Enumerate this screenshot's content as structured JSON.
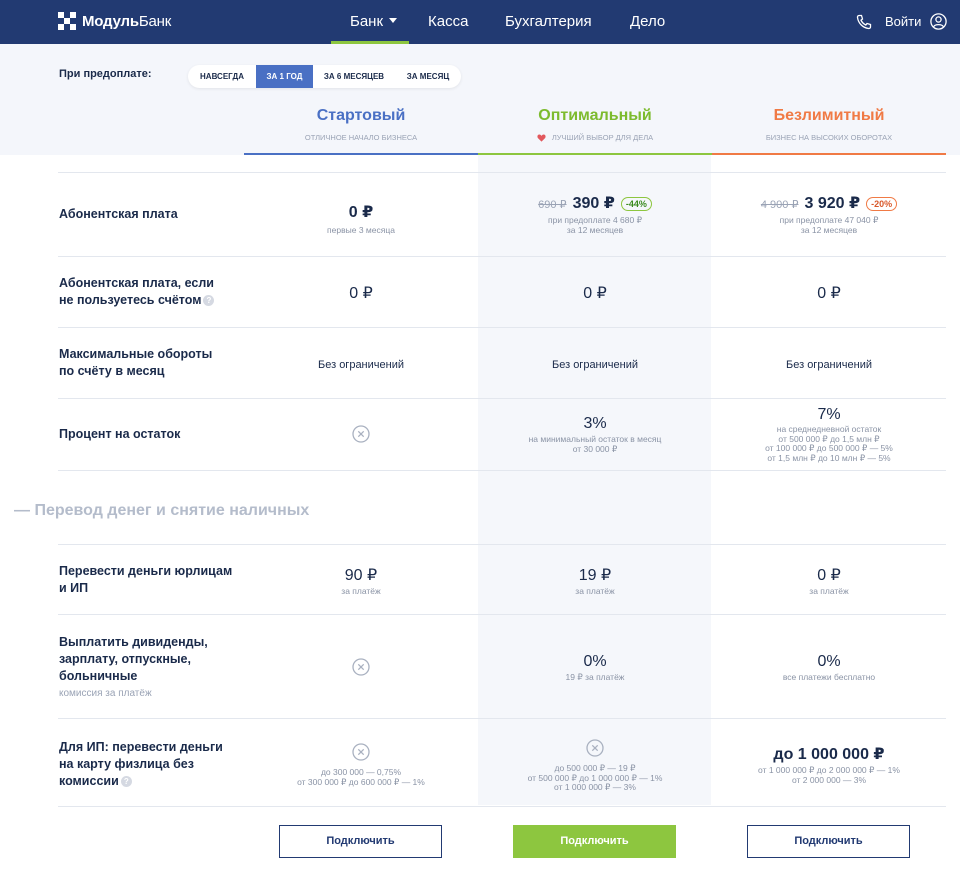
{
  "header": {
    "logo_bold": "Модуль",
    "logo_light": "Банк",
    "nav": [
      "Банк",
      "Касса",
      "Бухгалтерия",
      "Дело"
    ],
    "login": "Войти"
  },
  "prepay": {
    "label": "При предоплате:",
    "options": [
      "НАВСЕГДА",
      "ЗА 1 ГОД",
      "ЗА 6 МЕСЯЦЕВ",
      "ЗА МЕСЯЦ"
    ],
    "active": "ЗА 1 ГОД"
  },
  "plans": [
    {
      "name": "Стартовый",
      "sub": "ОТЛИЧНОЕ НАЧАЛО БИЗНЕСА",
      "color": "#4a70c4"
    },
    {
      "name": "Оптимальный",
      "sub": "ЛУЧШИЙ ВЫБОР ДЛЯ ДЕЛА",
      "color": "#8dc63f"
    },
    {
      "name": "Безлимитный",
      "sub": "БИЗНЕС НА ВЫСОКИХ ОБОРОТАХ",
      "color": "#f07a45"
    }
  ],
  "rows": {
    "fee": {
      "label": "Абонентская плата",
      "start_value": "0 ₽",
      "start_note": "первые 3 месяца",
      "opt_old": "690 ₽",
      "opt_value": "390 ₽",
      "opt_badge": "-44%",
      "opt_note1": "при предоплате 4 680 ₽",
      "opt_note2": "за 12 месяцев",
      "unl_old": "4 900 ₽",
      "unl_value": "3 920 ₽",
      "unl_badge": "-20%",
      "unl_note1": "при предоплате 47 040 ₽",
      "unl_note2": "за 12 месяцев"
    },
    "fee_unused": {
      "label1": "Абонентская плата, если",
      "label2": "не пользуетесь счётом",
      "start": "0 ₽",
      "opt": "0 ₽",
      "unl": "0 ₽"
    },
    "turnover": {
      "label1": "Максимальные обороты",
      "label2": "по счёту в месяц",
      "start": "Без ограничений",
      "opt": "Без ограничений",
      "unl": "Без ограничений"
    },
    "interest": {
      "label": "Процент на остаток",
      "opt_value": "3%",
      "opt_note1": "на минимальный остаток в месяц",
      "opt_note2": "от 30 000 ₽",
      "unl_value": "7%",
      "unl_note1": "на среднедневной остаток",
      "unl_note2": "от 500 000 ₽ до 1,5 млн ₽",
      "unl_note3": "от 100 000 ₽ до 500 000 ₽ — 5%",
      "unl_note4": "от 1,5 млн ₽ до 10 млн ₽ — 5%"
    }
  },
  "section": "— Перевод денег и снятие наличных",
  "rows2": {
    "transfer": {
      "label1": "Перевести деньги юрлицам",
      "label2": "и ИП",
      "start": "90 ₽",
      "opt": "19 ₽",
      "unl": "0 ₽",
      "note": "за платёж"
    },
    "salary": {
      "label1": "Выплатить дивиденды,",
      "label2": "зарплату, отпускные,",
      "label3": "больничные",
      "label_note": "комиссия за платёж",
      "opt_value": "0%",
      "opt_note": "19 ₽ за платёж",
      "unl_value": "0%",
      "unl_note": "все платежи бесплатно"
    },
    "card": {
      "label1": "Для ИП: перевести деньги",
      "label2": "на карту физлица без",
      "label3": "комиссии",
      "start_note1": "до 300 000 — 0,75%",
      "start_note2": "от 300 000 ₽ до 600 000 ₽ — 1%",
      "opt_note1": "до 500 000 ₽ — 19 ₽",
      "opt_note2": "от 500 000 ₽ до 1 000 000 ₽ — 1%",
      "opt_note3": "от 1 000 000 ₽ — 3%",
      "unl_value": "до 1 000 000 ₽",
      "unl_note1": "от 1 000 000 ₽ до 2 000 000 ₽ — 1%",
      "unl_note2": "от 2 000 000 — 3%"
    }
  },
  "buttons": {
    "start": "Подключить",
    "opt": "Подключить",
    "unl": "Подключить"
  },
  "colors": {
    "header": "#223a72",
    "accent_blue": "#4a70c4",
    "accent_green": "#8dc63f",
    "accent_orange": "#f07a45"
  }
}
